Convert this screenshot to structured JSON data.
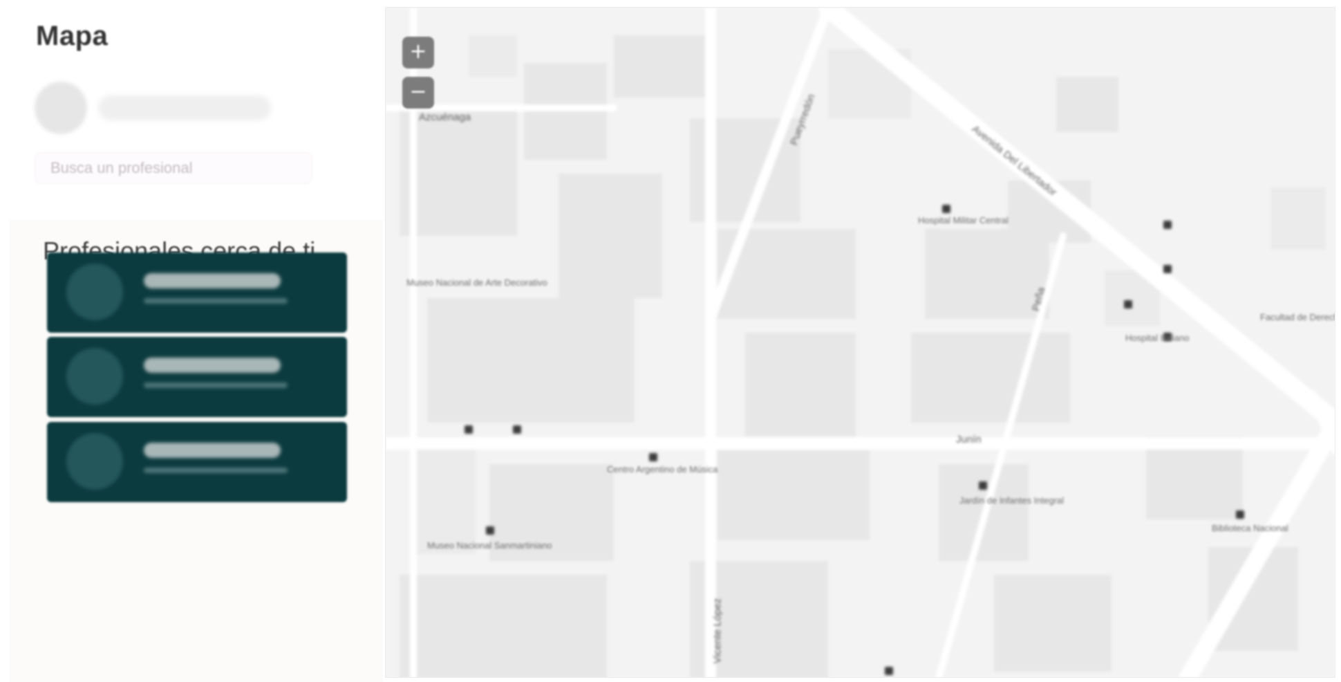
{
  "page": {
    "title": "Mapa"
  },
  "search": {
    "placeholder": "Busca un profesional"
  },
  "section": {
    "title": "Profesionales cerca de ti"
  },
  "colors": {
    "card_bg": "#0c3b3f",
    "card_avatar": "#23575b",
    "map_bg": "#f4f4f4",
    "zoom_btn": "#7c7c7c"
  },
  "map": {
    "zoom_in": "+",
    "zoom_out": "−",
    "streets": [
      "Azcuénaga",
      "Avenida Del Libertador",
      "Junín",
      "Pueyrredón",
      "Peña",
      "Vicente López"
    ],
    "pois": [
      "Hospital Militar Central",
      "Museo Nacional de Arte Decorativo",
      "Centro Argentino de Música",
      "Hospital Italiano",
      "Museo Nacional Sanmartiniano",
      "Jardín de Infantes Integral",
      "Biblioteca Nacional",
      "Facultad de Derecho"
    ]
  },
  "icons": [
    "plus-icon",
    "minus-icon",
    "poi-marker-icon",
    "avatar-placeholder"
  ]
}
